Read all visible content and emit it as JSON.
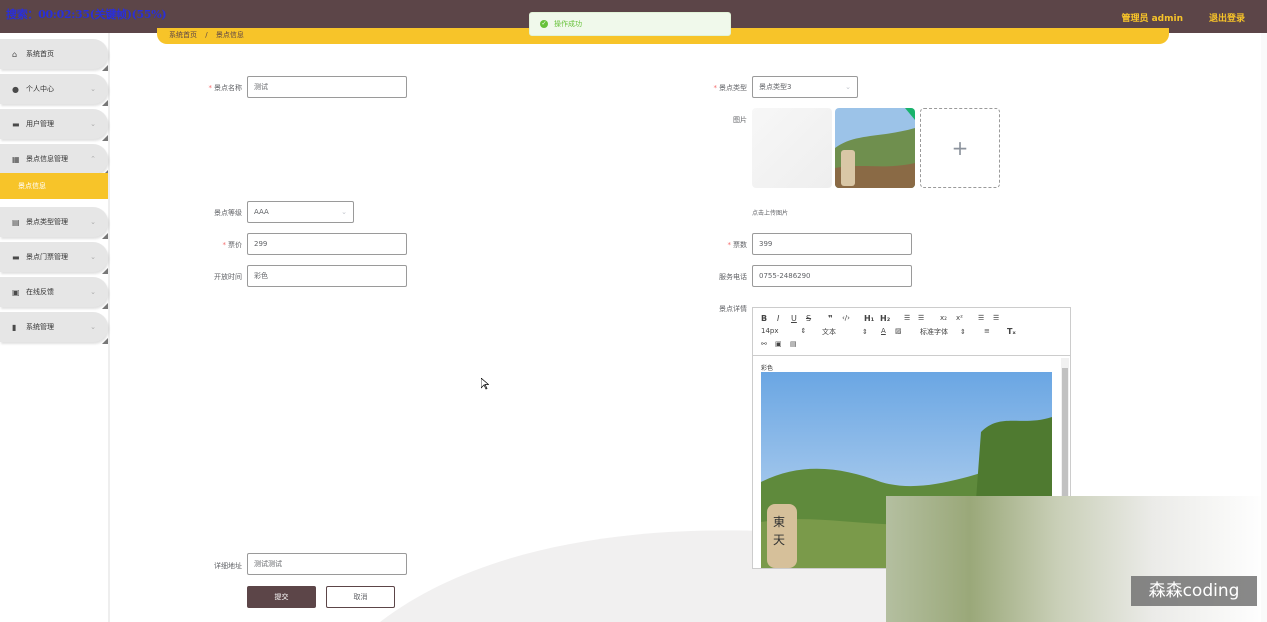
{
  "topbar": {
    "overlay_text": "搜索：00:02:35(关键帧)(55%)",
    "admin_label": "管理员 admin",
    "logout_label": "退出登录"
  },
  "toast": {
    "message": "操作成功"
  },
  "sidebar": {
    "items": [
      {
        "label": "系统首页",
        "icon": "home-icon"
      },
      {
        "label": "个人中心",
        "icon": "user-icon"
      },
      {
        "label": "用户管理",
        "icon": "users-icon"
      },
      {
        "label": "景点信息管理",
        "icon": "grid-icon"
      },
      {
        "label": "景点类型管理",
        "icon": "category-icon"
      },
      {
        "label": "景点门票管理",
        "icon": "ticket-icon"
      },
      {
        "label": "在线反馈",
        "icon": "feedback-icon"
      },
      {
        "label": "系统管理",
        "icon": "chart-icon"
      }
    ],
    "active_sub": "景点信息"
  },
  "breadcrumb": {
    "home": "系统首页",
    "separator": "/",
    "current": "景点信息"
  },
  "form": {
    "name_label": "景点名称",
    "name_value": "测试",
    "type_label": "景点类型",
    "type_value": "景点类型3",
    "image_label": "图片",
    "upload_hint": "点击上传图片",
    "level_label": "景点等级",
    "level_value": "AAA",
    "price_label": "票价",
    "price_value": "299",
    "tickets_label": "票数",
    "tickets_value": "399",
    "open_time_label": "开放时间",
    "open_time_value": "彩色",
    "phone_label": "服务电话",
    "phone_value": "0755-2486290",
    "detail_label": "景点详情",
    "address_label": "详细地址",
    "address_value": "测试测试",
    "submit_label": "提交",
    "cancel_label": "取消"
  },
  "editor": {
    "font_size": "14px",
    "text_type": "文本",
    "font_family": "标准字体",
    "content_text": "彩色"
  },
  "watermark": "森森coding",
  "colors": {
    "brand": "#5c4548",
    "accent": "#f7c429",
    "success": "#67c23a",
    "required": "#f56c6c"
  }
}
